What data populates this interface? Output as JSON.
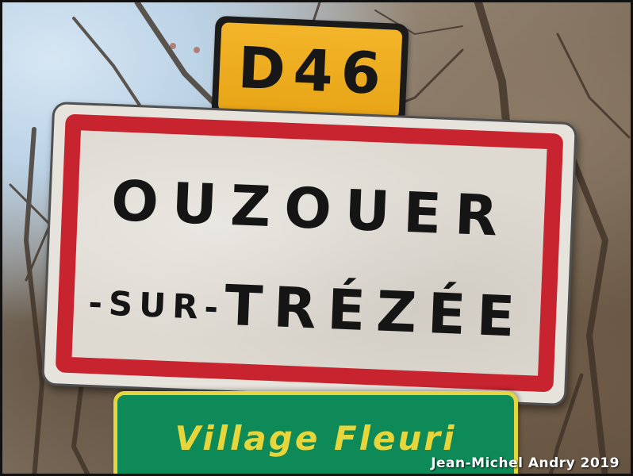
{
  "road_sign": {
    "number": "D46",
    "color": "#f3b52a"
  },
  "town_sign": {
    "line1": "OUZOUER",
    "line2_prefix": "-SUR-",
    "line2_name": "TRÉZÉE",
    "border_color": "#c8242f",
    "text_color": "#151515"
  },
  "village_sign": {
    "text": "Village Fleuri",
    "background_color": "#0e8a58",
    "text_color": "#e7d63b"
  },
  "watermark": {
    "text": "Jean-Michel Andry 2019"
  }
}
